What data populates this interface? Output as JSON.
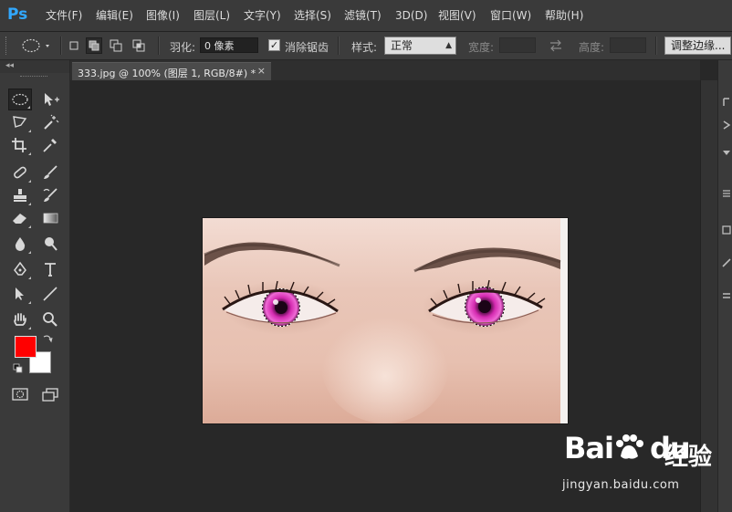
{
  "app": {
    "logo": "Ps"
  },
  "menu": [
    "文件(F)",
    "编辑(E)",
    "图像(I)",
    "图层(L)",
    "文字(Y)",
    "选择(S)",
    "滤镜(T)",
    "3D(D)",
    "视图(V)",
    "窗口(W)",
    "帮助(H)"
  ],
  "options": {
    "feather_label": "羽化:",
    "feather_value": "0 像素",
    "antialias_checked": true,
    "antialias_label": "消除锯齿",
    "style_label": "样式:",
    "style_value": "正常",
    "width_label": "宽度:",
    "height_label": "高度:",
    "refine_edge_label": "调整边缘..."
  },
  "document": {
    "tab_title": "333.jpg @ 100% (图层 1, RGB/8#) *",
    "close_glyph": "×"
  },
  "colors": {
    "foreground": "#ff0000",
    "background": "#ffffff",
    "ps_blue": "#31a8ff",
    "ui_dark": "#282828",
    "ui_panel": "#3a3a3a",
    "iris_magenta": "#d42bb0"
  },
  "tools": [
    "elliptical-marquee-tool",
    "move-tool",
    "polygonal-lasso-tool",
    "magic-wand-tool",
    "crop-tool",
    "eyedropper-tool",
    "spot-healing-brush-tool",
    "brush-tool",
    "clone-stamp-tool",
    "history-brush-tool",
    "eraser-tool",
    "gradient-tool",
    "blur-tool",
    "dodge-tool",
    "pen-tool",
    "type-tool",
    "path-selection-tool",
    "line-tool",
    "hand-tool",
    "zoom-tool"
  ],
  "watermark": {
    "logo_text": "Bai",
    "logo_text2": "du",
    "jingyan": "经验",
    "url": "jingyan.baidu.com"
  }
}
